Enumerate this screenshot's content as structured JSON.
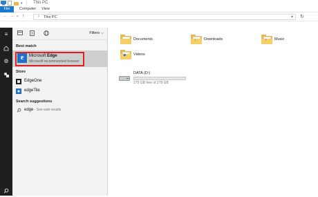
{
  "window": {
    "title": "This PC"
  },
  "ribbon": {
    "tabs": [
      "File",
      "Computer",
      "View"
    ]
  },
  "address": {
    "path": "This PC"
  },
  "content": {
    "folders": [
      {
        "label": "Documents",
        "icon": "documents-folder-icon"
      },
      {
        "label": "Downloads",
        "icon": "downloads-folder-icon"
      },
      {
        "label": "Music",
        "icon": "music-folder-icon"
      },
      {
        "label": "Videos",
        "icon": "videos-folder-icon"
      }
    ],
    "drive": {
      "label": "DATA (D:)",
      "free_text": "279 GB free of 279 GB",
      "used_fraction": 0.0
    }
  },
  "search": {
    "filters_label": "Filters",
    "best_match_header": "Best match",
    "best_match": {
      "title_prefix": "Microsoft ",
      "title_bold": "Edge",
      "subtitle": "Microsoft recommended browser"
    },
    "store_header": "Store",
    "store_items": [
      {
        "label": "EdgeOne"
      },
      {
        "label": "edgeTile"
      }
    ],
    "suggestions_header": "Search suggestions",
    "suggestion": {
      "query": "edge",
      "hint": " - See web results"
    }
  },
  "colors": {
    "accent": "#1979ca",
    "highlight_border": "#e02020",
    "rail": "#1f1f1f",
    "flyout_bg": "#f2f2f2",
    "selected_bg": "#cfcfcf"
  }
}
